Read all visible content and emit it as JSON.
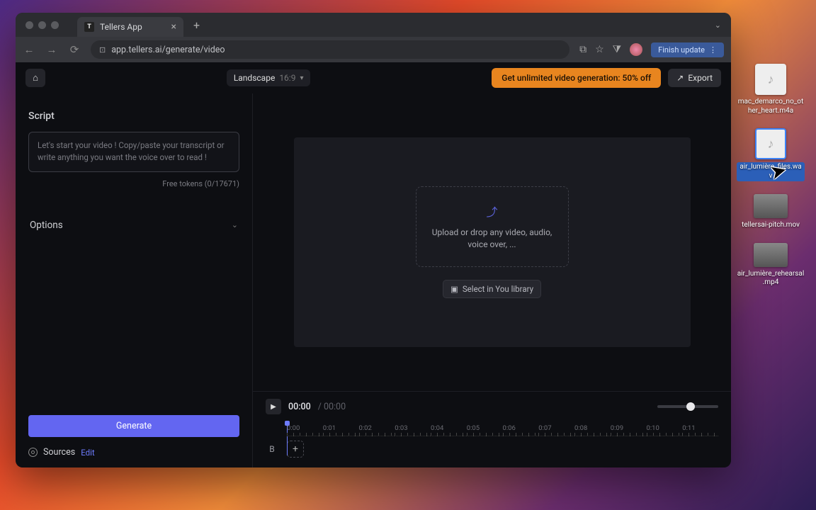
{
  "browser": {
    "tab_title": "Tellers App",
    "url": "app.tellers.ai/generate/video",
    "update_button": "Finish update"
  },
  "app": {
    "aspect_label": "Landscape",
    "aspect_ratio": "16:9",
    "promo": "Get unlimited video generation: 50% off",
    "export": "Export"
  },
  "sidebar": {
    "script_heading": "Script",
    "script_placeholder": "Let's start your video ! Copy/paste your transcript or write anything you want the voice over to read !",
    "tokens_label": "Free tokens (0/17671)",
    "options_label": "Options",
    "generate_label": "Generate",
    "sources_label": "Sources",
    "sources_edit": "Edit"
  },
  "stage": {
    "drop_text": "Upload or drop any video, audio, voice over, ...",
    "library_button": "Select in You library"
  },
  "timeline": {
    "current": "00:00",
    "total": "00:00",
    "track_label": "B",
    "ticks": [
      "0:00",
      "0:01",
      "0:02",
      "0:03",
      "0:04",
      "0:05",
      "0:06",
      "0:07",
      "0:08",
      "0:09",
      "0:10",
      "0:11"
    ]
  },
  "desktop_files": [
    {
      "name": "mac_demarco_no_other_heart.m4a",
      "kind": "audio"
    },
    {
      "name": "air_lumière_files.wav",
      "kind": "audio",
      "selected": true
    },
    {
      "name": "tellersai-pitch.mov",
      "kind": "video"
    },
    {
      "name": "air_lumière_rehearsal.mp4",
      "kind": "video"
    }
  ]
}
